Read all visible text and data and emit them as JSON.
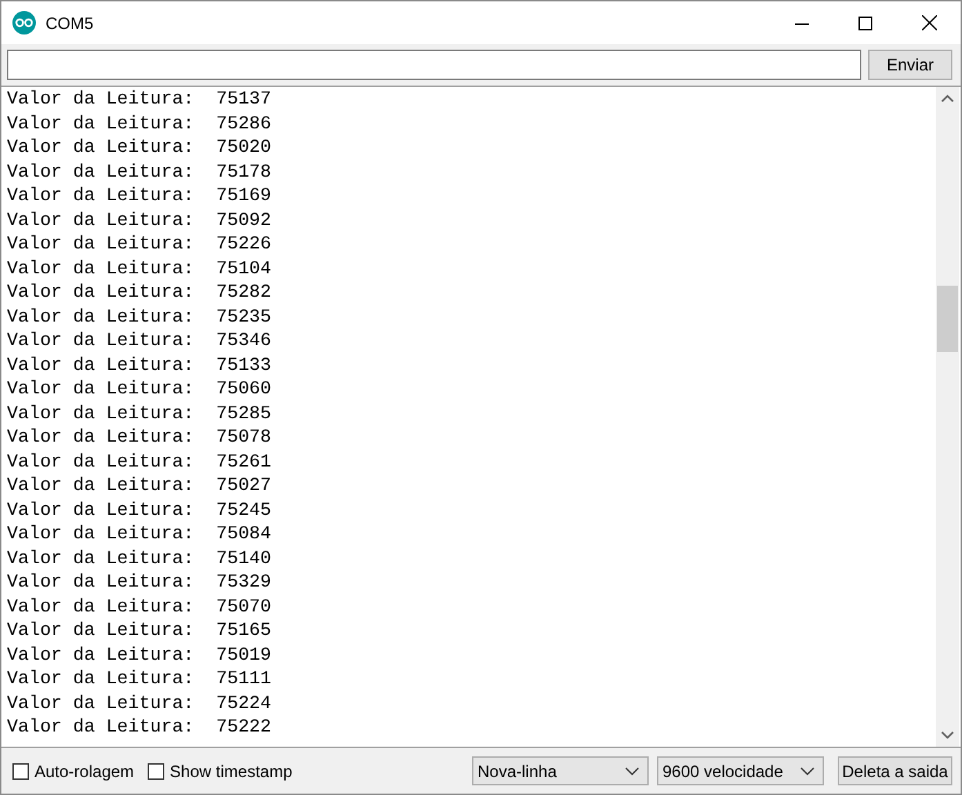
{
  "window": {
    "title": "COM5"
  },
  "send": {
    "button": "Enviar"
  },
  "output": [
    "Valor da Leitura:  75137",
    "Valor da Leitura:  75286",
    "Valor da Leitura:  75020",
    "Valor da Leitura:  75178",
    "Valor da Leitura:  75169",
    "Valor da Leitura:  75092",
    "Valor da Leitura:  75226",
    "Valor da Leitura:  75104",
    "Valor da Leitura:  75282",
    "Valor da Leitura:  75235",
    "Valor da Leitura:  75346",
    "Valor da Leitura:  75133",
    "Valor da Leitura:  75060",
    "Valor da Leitura:  75285",
    "Valor da Leitura:  75078",
    "Valor da Leitura:  75261",
    "Valor da Leitura:  75027",
    "Valor da Leitura:  75245",
    "Valor da Leitura:  75084",
    "Valor da Leitura:  75140",
    "Valor da Leitura:  75329",
    "Valor da Leitura:  75070",
    "Valor da Leitura:  75165",
    "Valor da Leitura:  75019",
    "Valor da Leitura:  75111",
    "Valor da Leitura:  75224",
    "Valor da Leitura:  75222"
  ],
  "options": [
    {
      "label": "Auto-rolagem",
      "checked": false
    },
    {
      "label": "Show timestamp",
      "checked": false
    }
  ],
  "dropdowns": [
    {
      "value": "Nova-linha"
    },
    {
      "value": "9600 velocidade"
    }
  ],
  "clear_button": "Deleta a saida"
}
